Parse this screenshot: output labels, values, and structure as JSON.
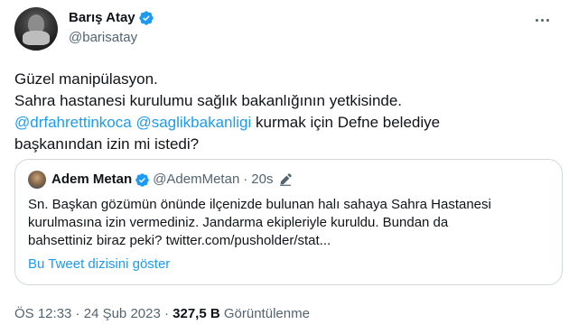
{
  "author": {
    "name": "Barış Atay",
    "handle": "@barisatay"
  },
  "tweet": {
    "line1": "Güzel manipülasyon.",
    "line2": "Sahra hastanesi kurulumu sağlık bakanlığının yetkisinde.",
    "mention1": "@drfahrettinkoca",
    "mention2": "@saglikbakanligi",
    "line3_rest": " kurmak için Defne belediye",
    "line4": "başkanından izin mi istedi?"
  },
  "quote": {
    "name": "Adem Metan",
    "handle": "@AdemMetan",
    "dot": "·",
    "time": "20s",
    "text_line1": "Sn. Başkan gözümün önünde ilçenizde bulunan halı sahaya Sahra Hastanesi",
    "text_line2": "kurulmasına izin vermediniz. Jandarma ekipleriyle kuruldu. Bundan da",
    "text_line3": "bahsettiniz biraz peki? twitter.com/pusholder/stat...",
    "thread_link": "Bu Tweet dizisini göster"
  },
  "meta": {
    "time": "ÖS 12:33",
    "sep1": " · ",
    "date": "24 Şub 2023",
    "sep2": " · ",
    "views_count": "327,5 B",
    "views_label": " Görüntülenme"
  },
  "colors": {
    "accent": "#1d9bf0",
    "text": "#0f1419",
    "secondary": "#536471",
    "border": "#cfd9de"
  },
  "icons": {
    "verified": "verified-badge-icon",
    "more": "more-options-icon",
    "edit": "edited-pencil-icon"
  }
}
